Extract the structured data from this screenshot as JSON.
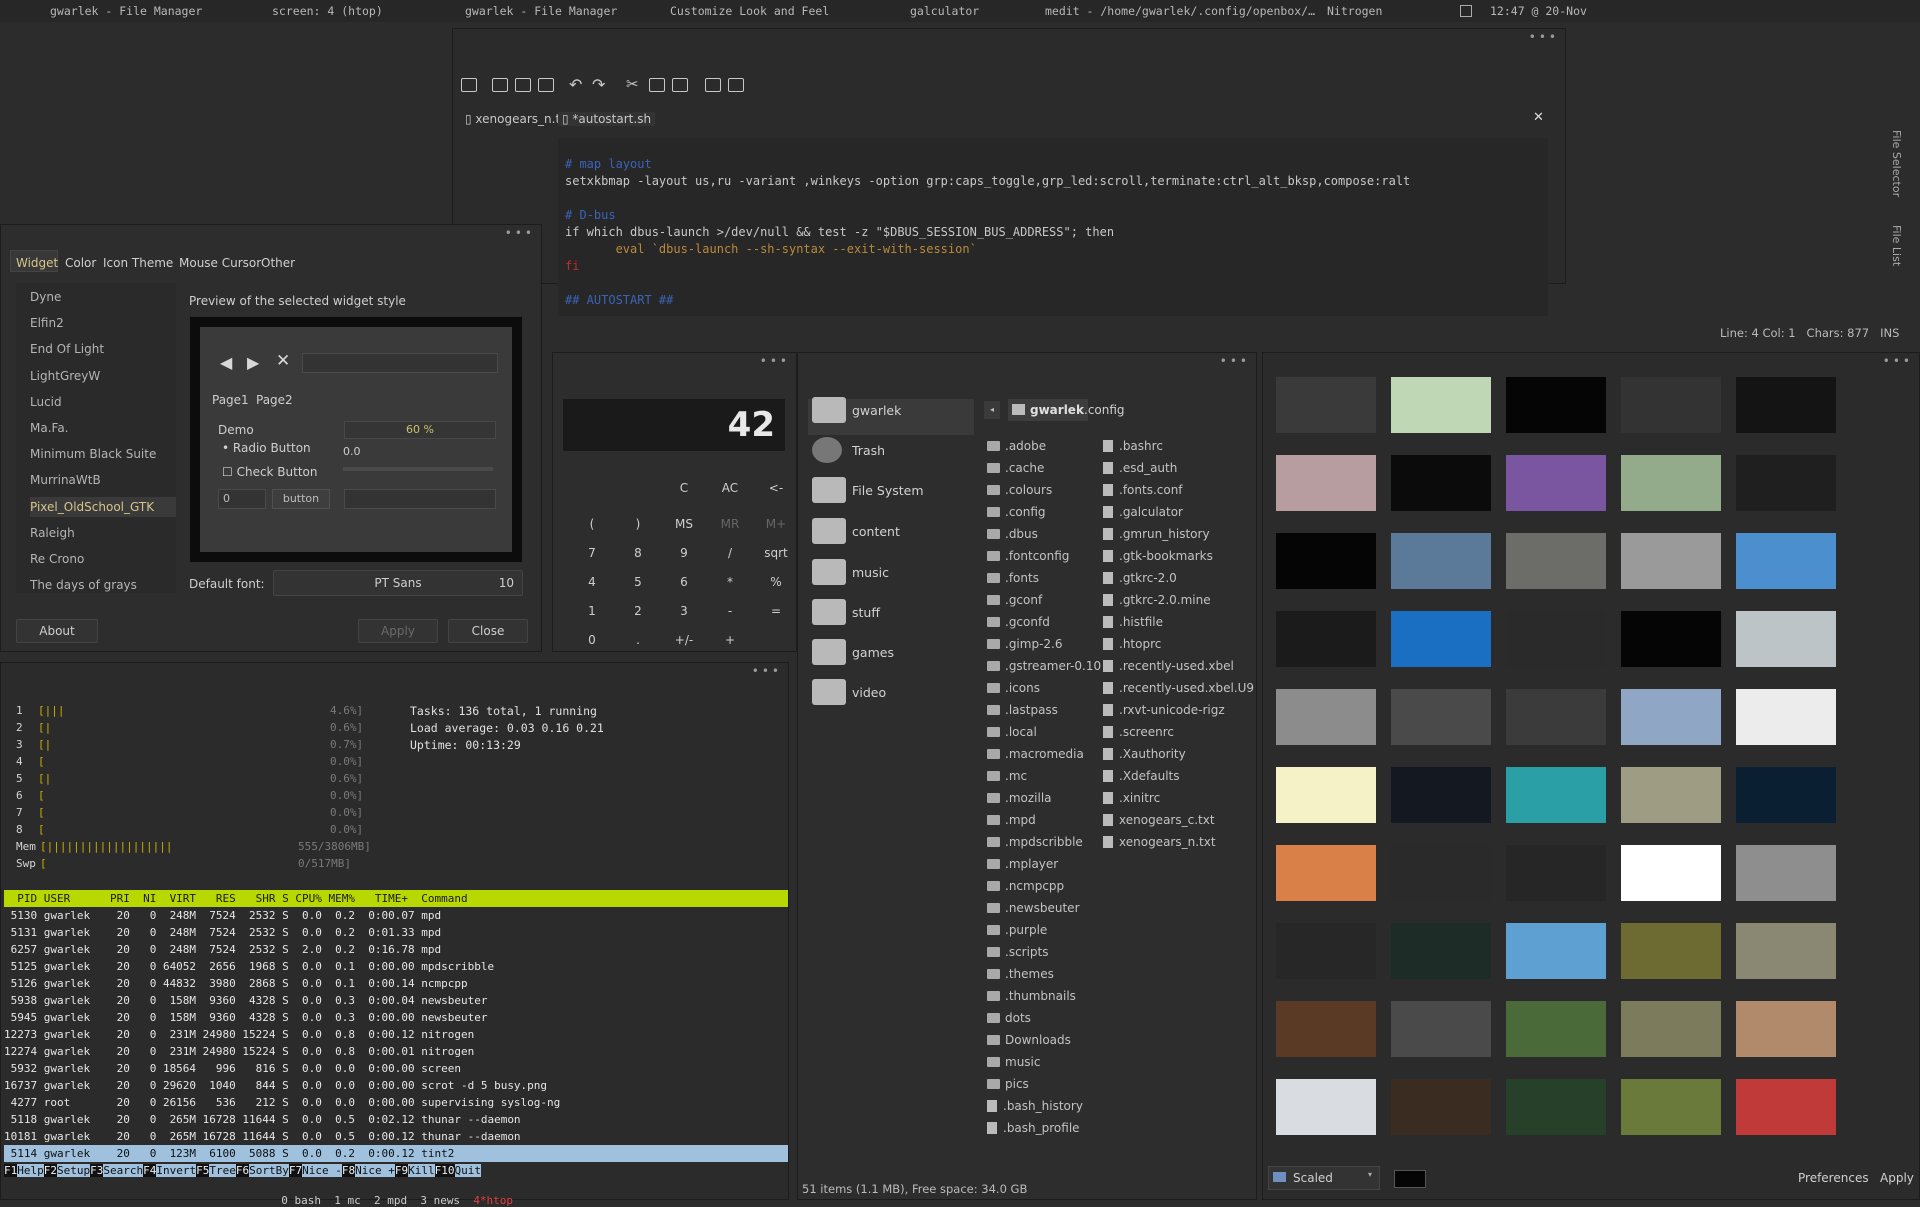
{
  "topbar": {
    "items": [
      "gwarlek - File Manager",
      "screen: 4 (htop)",
      "gwarlek - File Manager",
      "Customize Look and Feel",
      "galculator",
      "medit - /home/gwarlek/.config/openbox/…",
      "Nitrogen"
    ],
    "clock": "12:47 @ 20-Nov"
  },
  "editor": {
    "tabs": [
      "xenogears_n.txt",
      "*autostart.sh"
    ],
    "side_tabs": [
      "File Selector",
      "File List"
    ],
    "lines": [
      {
        "t": "# map layout",
        "c": "#3a63b8"
      },
      {
        "t": "setxkbmap -layout us,ru -variant ,winkeys -option grp:caps_toggle,grp_led:scroll,terminate:ctrl_alt_bksp,compose:ralt",
        "c": "#c8c8c8"
      },
      {
        "t": "",
        "c": "#c8c8c8"
      },
      {
        "t": "# D-bus",
        "c": "#3a63b8"
      },
      {
        "t": "if which dbus-launch >/dev/null && test -z \"$DBUS_SESSION_BUS_ADDRESS\"; then",
        "c": "#c8c8c8"
      },
      {
        "t": "       eval `dbus-launch --sh-syntax --exit-with-session`",
        "c": "#b98a3c"
      },
      {
        "t": "fi",
        "c": "#c12b2b"
      },
      {
        "t": "",
        "c": "#c8c8c8"
      },
      {
        "t": "## AUTOSTART ##",
        "c": "#3a63b8"
      }
    ],
    "status": {
      "pos": "Line: 4 Col: 1",
      "chars": "Chars: 877",
      "mode": "INS"
    }
  },
  "theme": {
    "tabs": [
      "Widget",
      "Color",
      "Icon Theme",
      "Mouse Cursor",
      "Other"
    ],
    "themes": [
      "Dyne",
      "Elfin2",
      "End Of Light",
      "LightGreyW",
      "Lucid",
      "Ma.Fa.",
      "Minimum Black Suite",
      "MurrinaWtB",
      "Pixel_OldSchool_GTK",
      "Raleigh",
      "Re Crono",
      "The days of grays"
    ],
    "selected": "Pixel_OldSchool_GTK",
    "preview_label": "Preview of the selected widget style",
    "preview": {
      "page1": "Page1",
      "page2": "Page2",
      "demo": "Demo",
      "progress": "60 %",
      "radio": "Radio Button",
      "check": "Check Button",
      "scale_val": "0.0",
      "spin_val": "0",
      "button": "button"
    },
    "font_label": "Default font:",
    "font_name": "PT Sans",
    "font_size": "10",
    "about": "About",
    "apply": "Apply",
    "close": "Close"
  },
  "calc": {
    "display": "42",
    "row0": [
      "C",
      "AC",
      "<-"
    ],
    "row1": [
      "(",
      ")",
      "MS",
      "MR",
      "M+"
    ],
    "rows": [
      [
        "7",
        "8",
        "9",
        "/",
        "sqrt"
      ],
      [
        "4",
        "5",
        "6",
        "*",
        "%"
      ],
      [
        "1",
        "2",
        "3",
        "-",
        "="
      ],
      [
        "0",
        ".",
        "+/-",
        "+",
        ""
      ]
    ]
  },
  "htop": {
    "cpus": [
      {
        "n": "1",
        "bar": "[|||",
        "pct": "4.6%]"
      },
      {
        "n": "2",
        "bar": "[|",
        "pct": "0.6%]"
      },
      {
        "n": "3",
        "bar": "[|",
        "pct": "0.7%]"
      },
      {
        "n": "4",
        "bar": "[",
        "pct": "0.0%]"
      },
      {
        "n": "5",
        "bar": "[|",
        "pct": "0.6%]"
      },
      {
        "n": "6",
        "bar": "[",
        "pct": "0.0%]"
      },
      {
        "n": "7",
        "bar": "[",
        "pct": "0.0%]"
      },
      {
        "n": "8",
        "bar": "[",
        "pct": "0.0%]"
      }
    ],
    "mem": {
      "label": "Mem",
      "bar": "[|||||||||||||||||||",
      "val": "555/3806MB]"
    },
    "swp": {
      "label": "Swp",
      "bar": "[",
      "val": "0/517MB]"
    },
    "tasks": "Tasks: 136 total, 1 running",
    "load": "Load average: 0.03 0.16 0.21",
    "uptime": "Uptime: 00:13:29",
    "header": "  PID USER      PRI  NI  VIRT   RES   SHR S CPU% MEM%   TIME+  Command",
    "rows": [
      " 5130 gwarlek    20   0  248M  7524  2532 S  0.0  0.2  0:00.07 mpd",
      " 5131 gwarlek    20   0  248M  7524  2532 S  0.0  0.2  0:01.33 mpd",
      " 6257 gwarlek    20   0  248M  7524  2532 S  2.0  0.2  0:16.78 mpd",
      " 5125 gwarlek    20   0 64052  2656  1968 S  0.0  0.1  0:00.00 mpdscribble",
      " 5126 gwarlek    20   0 44832  3980  2868 S  0.0  0.1  0:00.14 ncmpcpp",
      " 5938 gwarlek    20   0  158M  9360  4328 S  0.0  0.3  0:00.04 newsbeuter",
      " 5945 gwarlek    20   0  158M  9360  4328 S  0.0  0.3  0:00.00 newsbeuter",
      "12273 gwarlek    20   0  231M 24980 15224 S  0.0  0.8  0:00.12 nitrogen",
      "12274 gwarlek    20   0  231M 24980 15224 S  0.0  0.8  0:00.01 nitrogen",
      " 5932 gwarlek    20   0 18564   996   816 S  0.0  0.0  0:00.00 screen",
      "16737 gwarlek    20   0 29620  1040   844 S  0.0  0.0  0:00.00 scrot -d 5 busy.png",
      " 4277 root       20   0 26156   536   212 S  0.0  0.0  0:00.00 supervising syslog-ng",
      " 5118 gwarlek    20   0  265M 16728 11644 S  0.0  0.5  0:02.12 thunar --daemon",
      "10181 gwarlek    20   0  265M 16728 11644 S  0.0  0.5  0:00.12 thunar --daemon",
      " 5114 gwarlek    20   0  123M  6100  5088 S  0.0  0.2  0:00.12 tint2"
    ],
    "fkeys": [
      [
        "F1",
        "Help"
      ],
      [
        "F2",
        "Setup"
      ],
      [
        "F3",
        "Search"
      ],
      [
        "F4",
        "Invert"
      ],
      [
        "F5",
        "Tree"
      ],
      [
        "F6",
        "SortBy"
      ],
      [
        "F7",
        "Nice -"
      ],
      [
        "F8",
        "Nice +"
      ],
      [
        "F9",
        "Kill"
      ],
      [
        "F10",
        "Quit"
      ]
    ],
    "screens": "0 bash  1 mc  2 mpd  3 news",
    "screen_active": "4*htop"
  },
  "fm": {
    "places": [
      "gwarlek",
      "Trash",
      "File System",
      "content",
      "music",
      "stuff",
      "games",
      "video"
    ],
    "path": [
      "gwarlek",
      ".config"
    ],
    "col1": [
      ".adobe",
      ".cache",
      ".colours",
      ".config",
      ".dbus",
      ".fontconfig",
      ".fonts",
      ".gconf",
      ".gconfd",
      ".gimp-2.6",
      ".gstreamer-0.10",
      ".icons",
      ".lastpass",
      ".local",
      ".macromedia",
      ".mc",
      ".mozilla",
      ".mpd",
      ".mpdscribble",
      ".mplayer",
      ".ncmpcpp",
      ".newsbeuter",
      ".purple",
      ".scripts",
      ".themes",
      ".thumbnails",
      "dots",
      "Downloads",
      "music",
      "pics",
      ".bash_history",
      ".bash_profile"
    ],
    "col2": [
      ".bashrc",
      ".esd_auth",
      ".fonts.conf",
      ".galculator",
      ".gmrun_history",
      ".gtk-bookmarks",
      ".gtkrc-2.0",
      ".gtkrc-2.0.mine",
      ".histfile",
      ".htoprc",
      ".recently-used.xbel",
      ".recently-used.xbel.U9",
      ".rxvt-unicode-rigz",
      ".screenrc",
      ".Xauthority",
      ".Xdefaults",
      ".xinitrc",
      "xenogears_c.txt",
      "xenogears_n.txt"
    ],
    "status": "51 items (1.1 MB), Free space: 34.0 GB"
  },
  "nitrogen": {
    "mode": "Scaled",
    "preferences": "Preferences",
    "apply": "Apply",
    "thumb_colors": [
      "#3a3a3a",
      "#c0d7b6",
      "#050505",
      "#333333",
      "#141414",
      "#b79d9f",
      "#0b0b0b",
      "#7a55a0",
      "#93ab8b",
      "#1f1f1f",
      "#050505",
      "#5b7a9a",
      "#6c6c69",
      "#9a9a9a",
      "#4b8fcf",
      "#1b1b1b",
      "#1b6fc2",
      "#2a2a2a",
      "#050505",
      "#bcc4c8",
      "#8c8c8c",
      "#4a4a4a",
      "#3b3b3b",
      "#8fa6c4",
      "#ececec",
      "#f6f2c8",
      "#141821",
      "#2aa0a6",
      "#9e9c82",
      "#0b1f33",
      "#d98048",
      "#2a2a2a",
      "#262626",
      "#ffffff",
      "#8e8e8e",
      "#272727",
      "#1e2c27",
      "#5fa0d3",
      "#6d6a32",
      "#8a8773",
      "#5a3a24",
      "#4a4a4a",
      "#4a6a3a",
      "#7c7c5c",
      "#b08a6a",
      "#d9dde2",
      "#3a2c20",
      "#27402a",
      "#6a7a3a",
      "#c03a3a"
    ]
  }
}
